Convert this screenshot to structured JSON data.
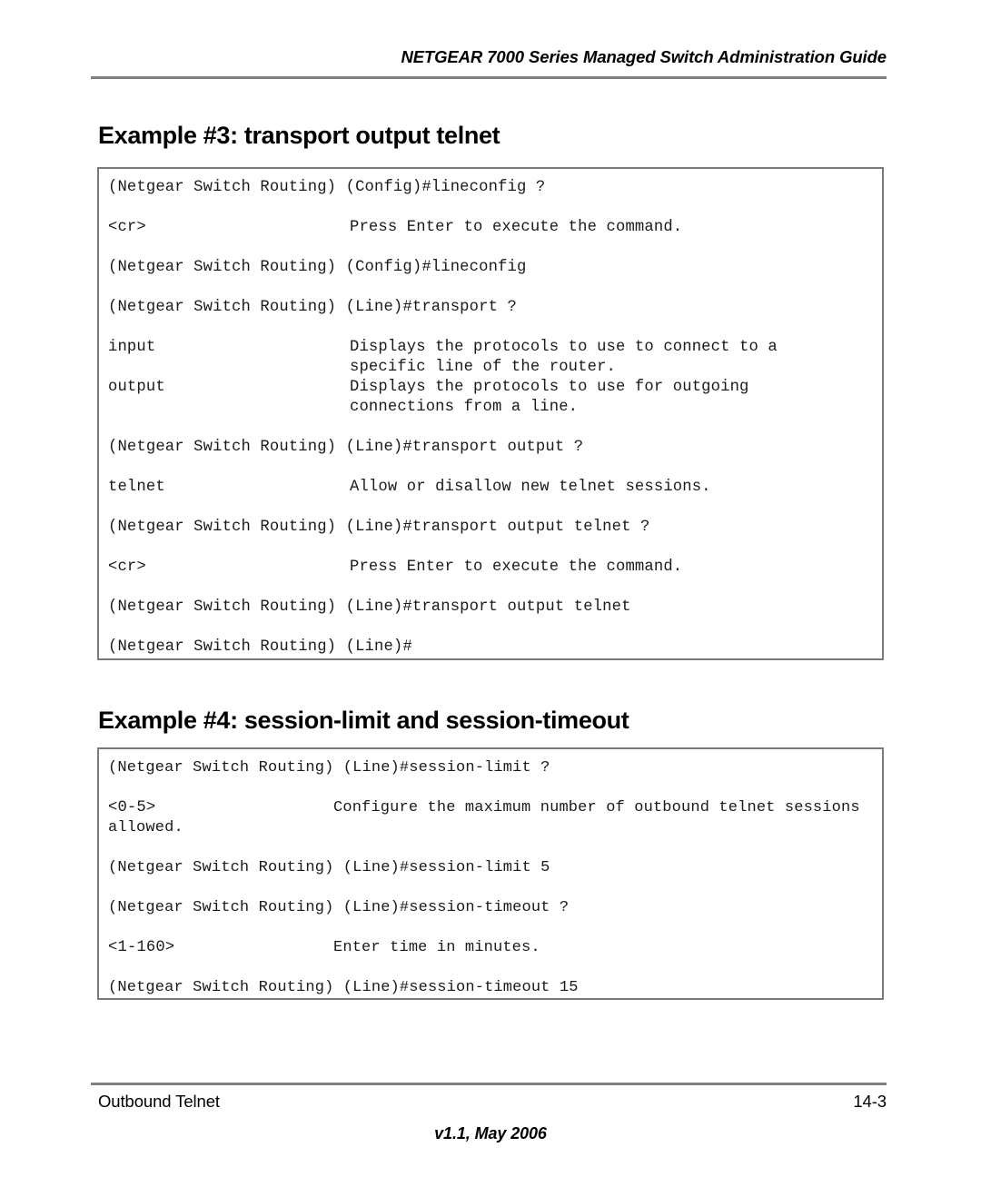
{
  "header": {
    "title": "NETGEAR 7000  Series Managed Switch Administration Guide"
  },
  "sections": [
    {
      "heading": "Example #3: transport output telnet",
      "lines": [
        {
          "type": "cmd",
          "text": "(Netgear Switch Routing) (Config)#lineconfig ?"
        },
        {
          "type": "blank"
        },
        {
          "type": "kv",
          "key": "<cr>",
          "desc": "Press Enter to execute the command."
        },
        {
          "type": "blank"
        },
        {
          "type": "cmd",
          "text": "(Netgear Switch Routing) (Config)#lineconfig"
        },
        {
          "type": "blank"
        },
        {
          "type": "cmd",
          "text": "(Netgear Switch Routing) (Line)#transport ?"
        },
        {
          "type": "blank"
        },
        {
          "type": "kv",
          "key": "input",
          "desc": "Displays the protocols to use to connect to a"
        },
        {
          "type": "kv",
          "key": "",
          "desc": "specific line of the router."
        },
        {
          "type": "kv",
          "key": "output",
          "desc": "Displays the protocols to use for outgoing"
        },
        {
          "type": "kv",
          "key": "",
          "desc": "connections from a line."
        },
        {
          "type": "blank"
        },
        {
          "type": "cmd",
          "text": "(Netgear Switch Routing) (Line)#transport output ?"
        },
        {
          "type": "blank"
        },
        {
          "type": "kv",
          "key": "telnet",
          "desc": "Allow or disallow new telnet sessions."
        },
        {
          "type": "blank"
        },
        {
          "type": "cmd",
          "text": "(Netgear Switch Routing) (Line)#transport output telnet ?"
        },
        {
          "type": "blank"
        },
        {
          "type": "kv",
          "key": "<cr>",
          "desc": "Press Enter to execute the command."
        },
        {
          "type": "blank"
        },
        {
          "type": "cmd",
          "text": "(Netgear Switch Routing) (Line)#transport output telnet"
        },
        {
          "type": "blank"
        },
        {
          "type": "cmd",
          "text": "(Netgear Switch Routing) (Line)#"
        }
      ]
    },
    {
      "heading": "Example #4: session-limit and session-timeout",
      "lines": [
        {
          "type": "cmd",
          "text": "(Netgear Switch Routing) (Line)#session-limit ?"
        },
        {
          "type": "blank"
        },
        {
          "type": "kv",
          "key": "<0-5>",
          "desc": "Configure the maximum number of outbound telnet sessions"
        },
        {
          "type": "cmd",
          "text": "allowed."
        },
        {
          "type": "blank"
        },
        {
          "type": "cmd",
          "text": "(Netgear Switch Routing) (Line)#session-limit 5"
        },
        {
          "type": "blank"
        },
        {
          "type": "cmd",
          "text": "(Netgear Switch Routing) (Line)#session-timeout ?"
        },
        {
          "type": "blank"
        },
        {
          "type": "kv",
          "key": "<1-160>",
          "desc": "Enter time in minutes."
        },
        {
          "type": "blank"
        },
        {
          "type": "cmd",
          "text": "(Netgear Switch Routing) (Line)#session-timeout 15"
        }
      ]
    }
  ],
  "footer": {
    "left": "Outbound Telnet",
    "right": "14-3",
    "center": "v1.1, May 2006"
  }
}
